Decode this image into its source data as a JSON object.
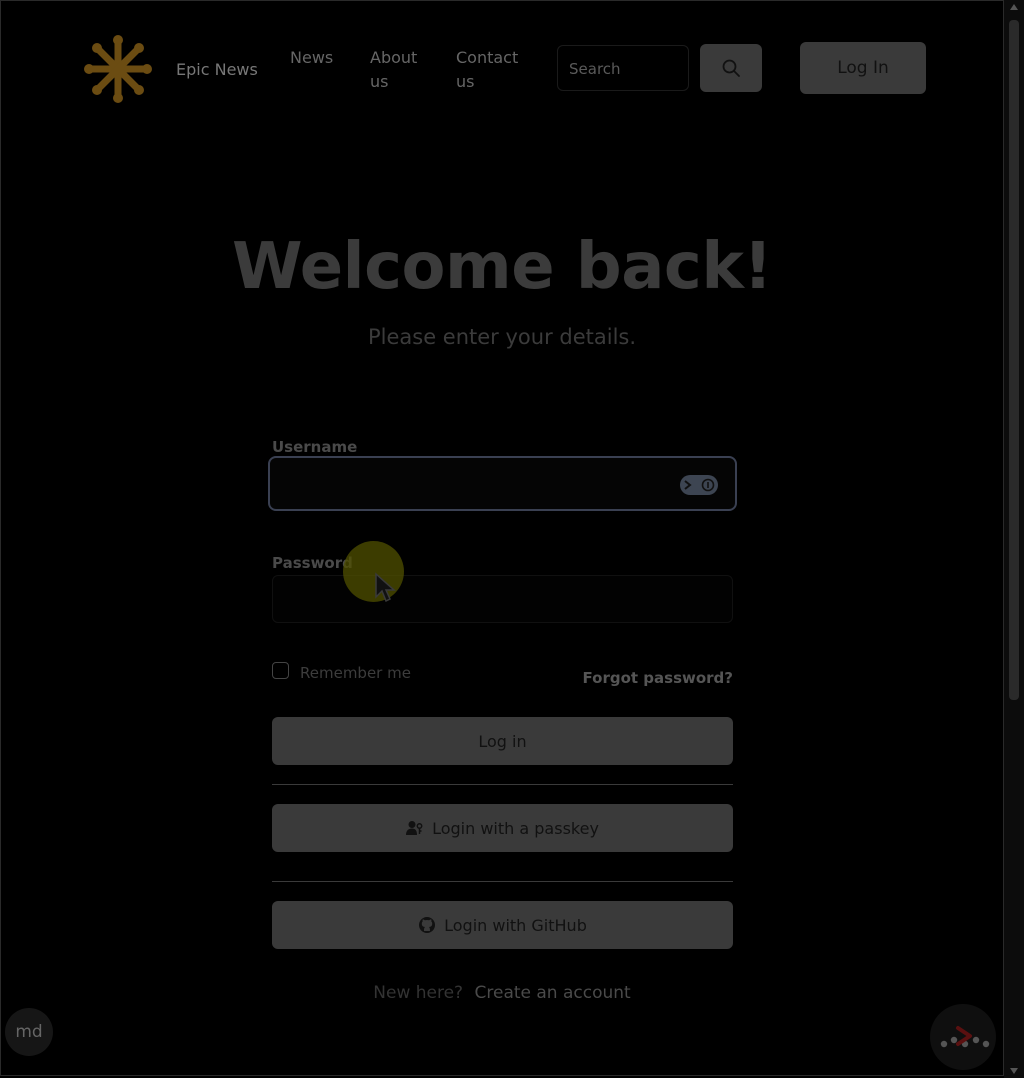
{
  "header": {
    "brand": "Epic News",
    "nav": [
      {
        "label": "News"
      },
      {
        "label": "About us"
      },
      {
        "label": "Contact us"
      }
    ],
    "search": {
      "placeholder": "Search"
    },
    "login_label": "Log In",
    "logo_color": "#6b4c12"
  },
  "login": {
    "title": "Welcome back!",
    "subtitle": "Please enter your details.",
    "username_label": "Username",
    "password_label": "Password",
    "remember_label": "Remember me",
    "forgot_label": "Forgot password?",
    "login_button": "Log in",
    "passkey_button": "Login with a passkey",
    "github_button": "Login with GitHub",
    "signup_prompt": "New here?",
    "signup_link": "Create an account"
  },
  "footer": {
    "theme_label": "md"
  },
  "colors": {
    "background": "#000000",
    "button": "#3a3a3a",
    "accent": "#6b4c12"
  }
}
